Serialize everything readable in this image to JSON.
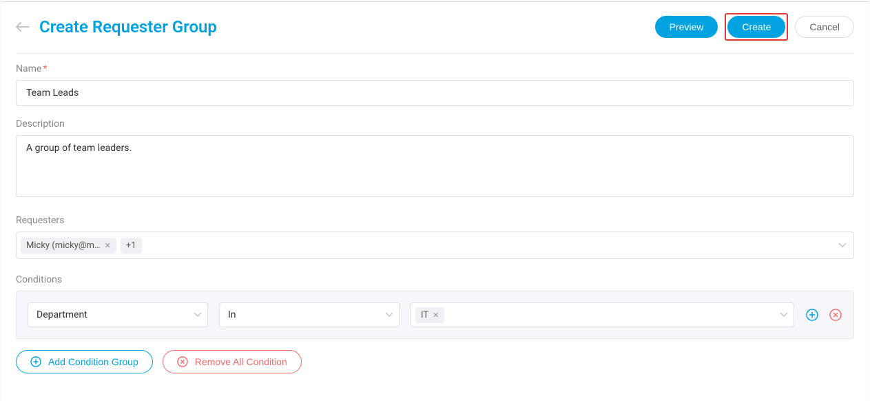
{
  "header": {
    "title": "Create Requester Group",
    "preview": "Preview",
    "create": "Create",
    "cancel": "Cancel"
  },
  "fields": {
    "name_label": "Name",
    "name_value": "Team Leads",
    "description_label": "Description",
    "description_value": "A group of team leaders.",
    "requesters_label": "Requesters",
    "requesters_tag": "Micky (micky@m…",
    "requesters_extra": "+1",
    "conditions_label": "Conditions"
  },
  "condition": {
    "field": "Department",
    "operator": "In",
    "value": "IT"
  },
  "actions": {
    "add_group": "Add Condition Group",
    "remove_all": "Remove All Condition"
  }
}
